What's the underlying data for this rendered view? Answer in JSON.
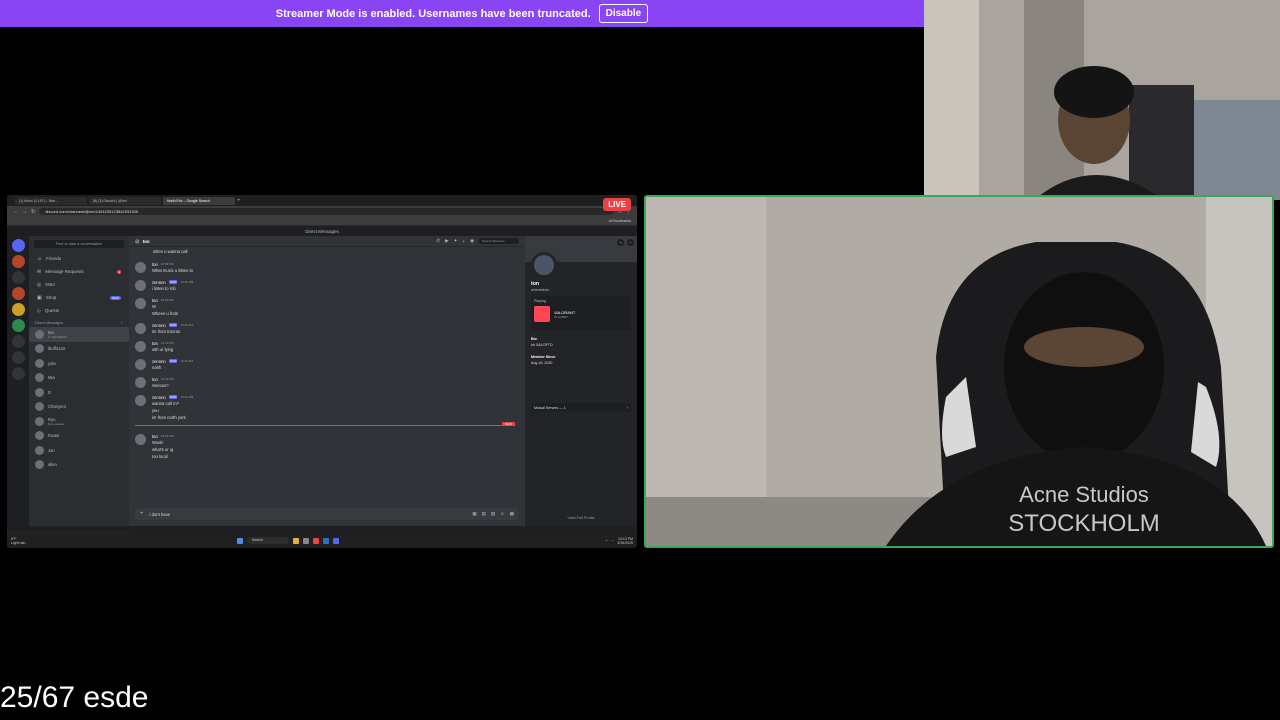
{
  "banner": {
    "text": "Streamer Mode is enabled. Usernames have been truncated.",
    "button": "Disable"
  },
  "live_badge": "LIVE",
  "caption": "25/67 esde",
  "browser": {
    "tabs": [
      "(1) Inbox (1,197) – Ban...",
      "(8) (3) Discord | @ton",
      "North Eric – Google Search"
    ],
    "url": "discord.com/channels/@me/1494235123842531935",
    "bookmarks": "All Bookmarks"
  },
  "discord": {
    "top_title": "Direct Messages",
    "search_placeholder": "Find or start a conversation",
    "nav": [
      {
        "icon": "friends-icon",
        "label": "Friends",
        "badge": ""
      },
      {
        "icon": "message-requests-icon",
        "label": "Message Requests",
        "badge": "1"
      },
      {
        "icon": "nitro-icon",
        "label": "Nitro",
        "badge": ""
      },
      {
        "icon": "shop-icon",
        "label": "Shop",
        "badge": "NEW"
      },
      {
        "icon": "quests-icon",
        "label": "Quests",
        "badge": ""
      }
    ],
    "dm_header": "Direct Messages",
    "dms": [
      {
        "name": "ton",
        "sub": "in VALORANT"
      },
      {
        "name": "lbuff4132",
        "sub": ""
      },
      {
        "name": "yola",
        "sub": ""
      },
      {
        "name": "Mia",
        "sub": ""
      },
      {
        "name": "D",
        "sub": ""
      },
      {
        "name": "Chanyeol",
        "sub": ""
      },
      {
        "name": "Ryu",
        "sub": "lilo Lovelace"
      },
      {
        "name": "Kwasi",
        "sub": ""
      },
      {
        "name": "Jan",
        "sub": ""
      },
      {
        "name": "allen",
        "sub": ""
      }
    ],
    "user": {
      "name": "zennnn",
      "status": "Invisible"
    },
    "chat": {
      "recipient": "ton",
      "search_placeholder": "Search wherever",
      "first_line": "when u wanna call",
      "messages": [
        {
          "name": "ton",
          "tag": "",
          "time": "10:09 PM",
          "lines": [
            "What music u listen to"
          ]
        },
        {
          "name": "zennnn",
          "tag": "1600",
          "time": "10:10 PM",
          "lines": [
            "i listen to rnb"
          ]
        },
        {
          "name": "ton",
          "tag": "",
          "time": "10:10 PM",
          "lines": [
            "W",
            "Wheee u from"
          ]
        },
        {
          "name": "zennnn",
          "tag": "1600",
          "time": "10:11 PM",
          "lines": [
            "im from toronto"
          ]
        },
        {
          "name": "ton",
          "tag": "",
          "time": "10:11 PM",
          "lines": [
            "wth ur lying"
          ]
        },
        {
          "name": "zennnn",
          "tag": "1600",
          "time": "10:11 PM",
          "lines": [
            "nahh"
          ]
        },
        {
          "name": "ton",
          "tag": "",
          "time": "10:12 PM",
          "lines": [
            "Serious?"
          ]
        },
        {
          "name": "zennnn",
          "tag": "1600",
          "time": "10:12 PM",
          "lines": [
            "wanna call rn?",
            "yeu",
            "im from north york"
          ]
        },
        {
          "name": "ton",
          "tag": "",
          "time": "10:12 PM",
          "lines": [
            "Woah",
            "what's ur ig",
            "Ioo local"
          ]
        }
      ],
      "new_label": "NEW",
      "composer_text": "i dont have"
    },
    "profile": {
      "name": "ton",
      "username": "wherewhen",
      "playing_label": "Playing",
      "game": "VALORANT",
      "game_sub": "IN LOBBY",
      "bio_label": "Bio",
      "bio": "bh SALOFTD",
      "member_since_label": "Member Since",
      "member_since": "Aug 16, 2020",
      "mutual": "Mutual Servers — 1",
      "view_full": "View Full Profile"
    }
  },
  "taskbar": {
    "weather": [
      "5°F",
      "Light rain"
    ],
    "search": "Search",
    "time": "10:13 PM",
    "date": "3/16/2025"
  }
}
